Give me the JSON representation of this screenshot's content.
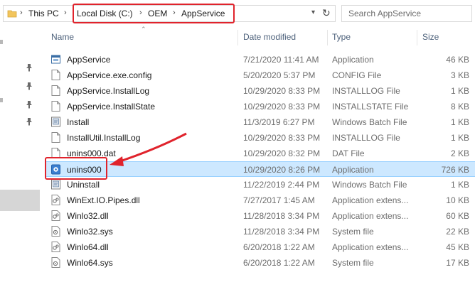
{
  "address": {
    "breadcrumbs": [
      "This PC",
      "Local Disk (C:)",
      "OEM",
      "AppService"
    ],
    "search_placeholder": "Search AppService"
  },
  "columns": {
    "name": "Name",
    "date": "Date modified",
    "type": "Type",
    "size": "Size"
  },
  "files": [
    {
      "name": "AppService",
      "date": "7/21/2020 11:41 AM",
      "type": "Application",
      "size": "46 KB",
      "icon": "app-icon"
    },
    {
      "name": "AppService.exe.config",
      "date": "5/20/2020 5:37 PM",
      "type": "CONFIG File",
      "size": "3 KB",
      "icon": "file-icon"
    },
    {
      "name": "AppService.InstallLog",
      "date": "10/29/2020 8:33 PM",
      "type": "INSTALLLOG File",
      "size": "1 KB",
      "icon": "file-icon"
    },
    {
      "name": "AppService.InstallState",
      "date": "10/29/2020 8:33 PM",
      "type": "INSTALLSTATE File",
      "size": "8 KB",
      "icon": "file-icon"
    },
    {
      "name": "Install",
      "date": "11/3/2019 6:27 PM",
      "type": "Windows Batch File",
      "size": "1 KB",
      "icon": "batch-icon"
    },
    {
      "name": "InstallUtil.InstallLog",
      "date": "10/29/2020 8:33 PM",
      "type": "INSTALLLOG File",
      "size": "1 KB",
      "icon": "file-icon"
    },
    {
      "name": "unins000.dat",
      "date": "10/29/2020 8:32 PM",
      "type": "DAT File",
      "size": "2 KB",
      "icon": "file-icon"
    },
    {
      "name": "unins000",
      "date": "10/29/2020 8:26 PM",
      "type": "Application",
      "size": "726 KB",
      "icon": "setup-icon",
      "selected": true
    },
    {
      "name": "Uninstall",
      "date": "11/22/2019 2:44 PM",
      "type": "Windows Batch File",
      "size": "1 KB",
      "icon": "batch-icon"
    },
    {
      "name": "WinExt.IO.Pipes.dll",
      "date": "7/27/2017 1:45 AM",
      "type": "Application extens...",
      "size": "10 KB",
      "icon": "dll-icon"
    },
    {
      "name": "Winlo32.dll",
      "date": "11/28/2018 3:34 PM",
      "type": "Application extens...",
      "size": "60 KB",
      "icon": "dll-icon"
    },
    {
      "name": "Winlo32.sys",
      "date": "11/28/2018 3:34 PM",
      "type": "System file",
      "size": "22 KB",
      "icon": "sys-icon"
    },
    {
      "name": "Winlo64.dll",
      "date": "6/20/2018 1:22 AM",
      "type": "Application extens...",
      "size": "45 KB",
      "icon": "dll-icon"
    },
    {
      "name": "Winlo64.sys",
      "date": "6/20/2018 1:22 AM",
      "type": "System file",
      "size": "17 KB",
      "icon": "sys-icon"
    }
  ],
  "colors": {
    "highlight": "#e0232c",
    "selection": "#cde8ff",
    "header_text": "#4c607a"
  }
}
